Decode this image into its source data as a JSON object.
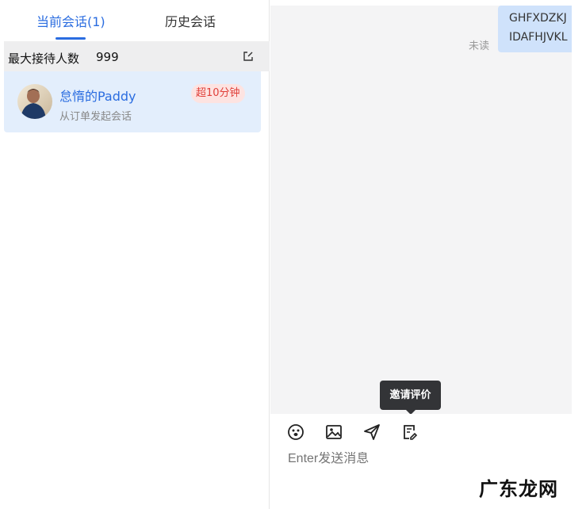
{
  "tabs": {
    "current": "当前会话(1)",
    "history": "历史会话"
  },
  "max_reception": {
    "label": "最大接待人数",
    "value": "999"
  },
  "conversation": {
    "name": "怠惰的Paddy",
    "source": "从订单发起会话",
    "badge": "超10分钟"
  },
  "message": {
    "line1": "GHFXDZKJ",
    "line2": "IDAFHJVKL",
    "status": "未读"
  },
  "composer": {
    "tooltip": "邀请评价",
    "placeholder": "Enter发送消息",
    "tools": [
      "emoji-icon",
      "image-icon",
      "send-plane-icon",
      "evaluation-icon"
    ]
  },
  "watermark": "广东龙网",
  "colors": {
    "accent": "#2b6de0",
    "selected_bg": "#e3eefc",
    "badge_red": "#e0403a",
    "bubble": "#cfe2fb"
  }
}
